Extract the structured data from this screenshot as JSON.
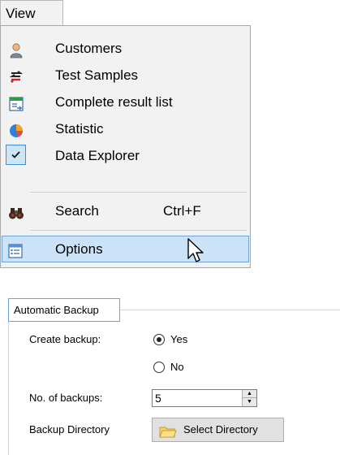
{
  "menu": {
    "title": "View",
    "items": [
      {
        "label": "Customers",
        "icon": "customer-icon"
      },
      {
        "label": "Test Samples",
        "icon": "test-samples-icon"
      },
      {
        "label": "Complete result list",
        "icon": "result-list-icon"
      },
      {
        "label": "Statistic",
        "icon": "pie-chart-icon"
      },
      {
        "label": "Data Explorer",
        "icon": "checkmark-icon",
        "checked": true
      },
      {
        "label": "Search",
        "icon": "binoculars-icon",
        "shortcut": "Ctrl+F"
      },
      {
        "label": "Options",
        "icon": "options-icon",
        "highlighted": true
      }
    ]
  },
  "backup": {
    "group_title": "Automatic Backup",
    "create_label": "Create backup:",
    "yes_label": "Yes",
    "no_label": "No",
    "selected": "Yes",
    "count_label": "No. of backups:",
    "count_value": "5",
    "dir_label": "Backup Directory",
    "dir_button": "Select Directory"
  },
  "colors": {
    "highlight": "#cce3f7",
    "highlight_border": "#6aa4d9",
    "menu_bg": "#f2f2f2"
  }
}
